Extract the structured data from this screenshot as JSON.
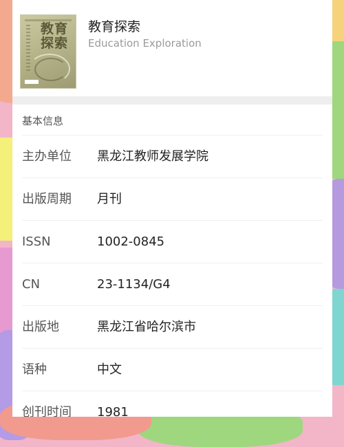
{
  "journal": {
    "title": "教育探索",
    "subtitle": "Education Exploration",
    "cover_title": "教育探索"
  },
  "section": {
    "label": "基本信息"
  },
  "info_rows": [
    {
      "key": "主办单位",
      "value": "黑龙江教师发展学院"
    },
    {
      "key": "出版周期",
      "value": "月刊"
    },
    {
      "key": "ISSN",
      "value": "1002-0845"
    },
    {
      "key": "CN",
      "value": "23-1134/G4"
    },
    {
      "key": "出版地",
      "value": "黑龙江省哈尔滨市"
    },
    {
      "key": "语种",
      "value": "中文"
    },
    {
      "key": "创刊时间",
      "value": "1981"
    }
  ]
}
